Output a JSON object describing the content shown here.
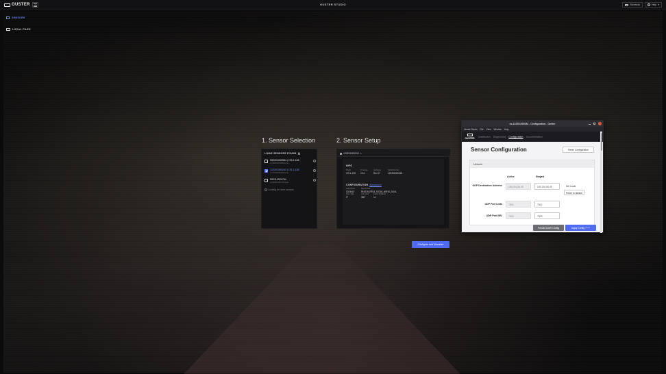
{
  "topbar": {
    "logo_text": "OUSTER",
    "app_title": "OUSTER STUDIO",
    "shortcuts_label": "Shortcuts",
    "help_label": "Help"
  },
  "sidebar": {
    "items": [
      {
        "label": "SENSORS",
        "icon": "list-icon",
        "active": true
      },
      {
        "label": "LOCAL FILES",
        "icon": "folder-icon",
        "active": false
      }
    ]
  },
  "selection": {
    "title": "1. Sensor Selection",
    "heading": "LIDAR SENSORS FOUND",
    "sensors": [
      {
        "name": "992201000554 | OS-0-128",
        "sub": "os-992201000554.local",
        "checked": false
      },
      {
        "name": "122201000243 | OS-1-128",
        "sub": "os-122201000243.local",
        "checked": true
      },
      {
        "name": "992112001764",
        "sub": "os-992112001764.local",
        "checked": false
      }
    ],
    "looking_text": "Looking for more sensors"
  },
  "setup": {
    "title": "2. Sensor Setup",
    "tab_label": "122201000243",
    "info_heading": "INFO",
    "info": [
      {
        "key": "Model",
        "value": "OS-1-128"
      },
      {
        "key": "Firmware",
        "value": "2.3.1"
      },
      {
        "key": "Hardware",
        "value": "Rev 07"
      },
      {
        "key": "Serial Number",
        "value": "122201000243"
      }
    ],
    "config_heading": "CONFIGURATION",
    "advanced_label": "Advanced",
    "config": [
      {
        "key": "Lidar Mode",
        "value": "1024x10"
      },
      {
        "key": "Data Profile",
        "value": "RNG19_RFL8_SIG16_NIR16_DUAL"
      },
      {
        "key": "Azim Start",
        "value": "0°"
      },
      {
        "key": "Azim End",
        "value": "360°"
      },
      {
        "key": "Signal Multiplier",
        "value": "1x"
      }
    ]
  },
  "configure_button": "Configure and Visualize",
  "window": {
    "title": "os-122201000243 - Configuration - Ouster",
    "menu": [
      "Ouster Studio",
      "File",
      "View",
      "Window",
      "Help"
    ],
    "logo_text": "OUSTER",
    "nav": [
      {
        "label": "Dashboard",
        "active": false
      },
      {
        "label": "Diagnostics",
        "active": false
      },
      {
        "label": "Configuration",
        "active": true
      },
      {
        "label": "Documentation",
        "active": false
      }
    ],
    "heading": "Sensor Configuration",
    "reset_button": "Reset Configuration",
    "card_title": "Network",
    "col_active": "Active",
    "col_staged": "Staged",
    "rows": {
      "udp_dest_label": "UDP Destination Address",
      "udp_dest_active": "169.254.56.45",
      "udp_dest_staged": "169.254.56.45",
      "set_local": "Set Local",
      "reset_default": "Reset to default",
      "udp_lidar_label": "UDP Port Lidar",
      "udp_lidar_active": "7502",
      "udp_lidar_staged": "7502",
      "udp_imu_label": "UDP Port IMU",
      "udp_imu_active": "7503",
      "udp_imu_staged": "7503"
    },
    "persist_button": "Persist Active Config",
    "apply_button": "Apply Config",
    "apply_hint": "(none)"
  },
  "colors": {
    "accent": "#4f6cf0",
    "background": "#0b0b0c",
    "close": "#e2553d"
  }
}
